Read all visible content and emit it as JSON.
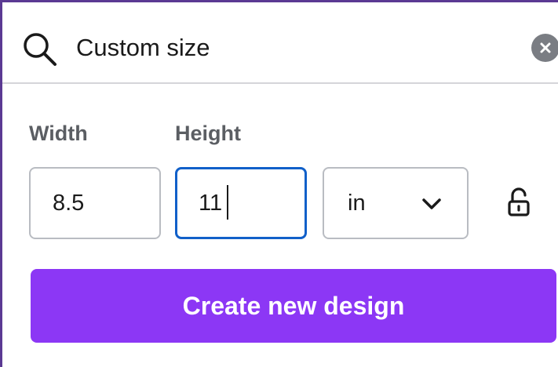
{
  "search": {
    "value": "Custom size",
    "placeholder": "",
    "icon": "search-icon",
    "clear_icon": "close-icon"
  },
  "fields": {
    "width_label": "Width",
    "height_label": "Height",
    "width_value": "8.5",
    "height_value": "11"
  },
  "unit": {
    "selected": "in",
    "icon": "chevron-down-icon"
  },
  "lock": {
    "icon": "unlocked-padlock-icon",
    "locked": false
  },
  "actions": {
    "create_label": "Create new design"
  },
  "colors": {
    "accent": "#8c37f5",
    "focus": "#1160c9",
    "frame": "#5b3a93"
  }
}
